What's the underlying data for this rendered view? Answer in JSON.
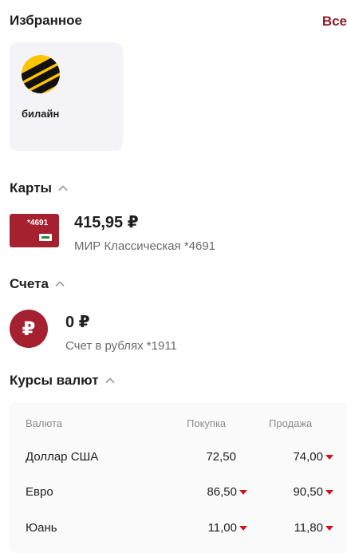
{
  "favorites": {
    "title": "Избранное",
    "all_link": "Все",
    "items": [
      {
        "label": "билайн",
        "icon": "beeline-logo"
      }
    ]
  },
  "cards": {
    "title": "Карты",
    "items": [
      {
        "thumb_number": "*4691",
        "balance": "415,95 ₽",
        "name": "МИР Классическая *4691"
      }
    ]
  },
  "accounts": {
    "title": "Счета",
    "items": [
      {
        "icon_glyph": "₽",
        "balance": "0 ₽",
        "name": "Счет в рублях *1911"
      }
    ]
  },
  "rates": {
    "title": "Курсы валют",
    "headers": {
      "currency": "Валюта",
      "buy": "Покупка",
      "sell": "Продажа"
    },
    "rows": [
      {
        "currency": "Доллар США",
        "buy": "72,50",
        "buy_down": false,
        "sell": "74,00",
        "sell_down": true
      },
      {
        "currency": "Евро",
        "buy": "86,50",
        "buy_down": true,
        "sell": "90,50",
        "sell_down": true
      },
      {
        "currency": "Юань",
        "buy": "11,00",
        "buy_down": true,
        "sell": "11,80",
        "sell_down": true
      }
    ]
  },
  "colors": {
    "accent": "#a5212f",
    "link": "#8a1c24",
    "down_indicator": "#d3121f"
  }
}
